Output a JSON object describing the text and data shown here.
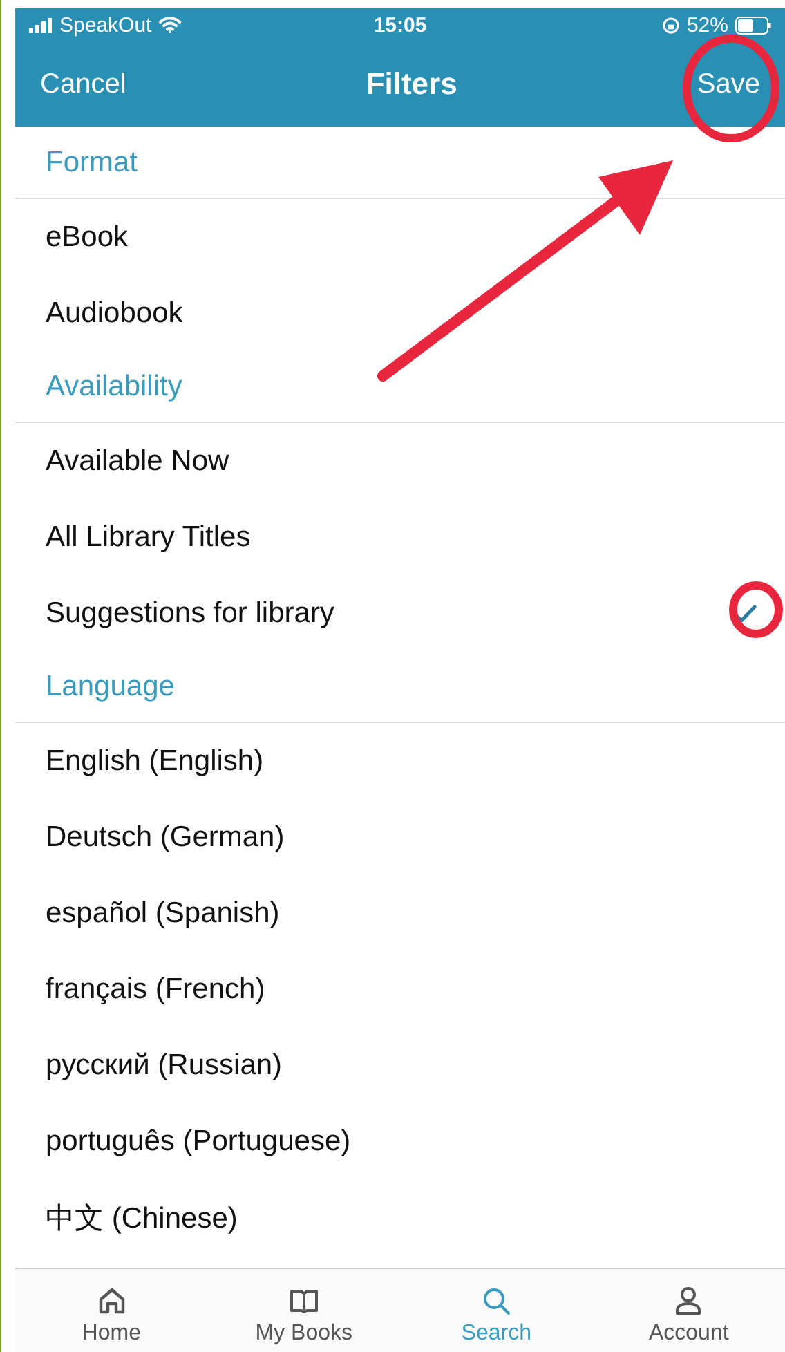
{
  "status_bar": {
    "carrier": "SpeakOut",
    "time": "15:05",
    "battery": "52%"
  },
  "nav": {
    "cancel": "Cancel",
    "title": "Filters",
    "save": "Save"
  },
  "sections": [
    {
      "title": "Format",
      "items": [
        {
          "label": "eBook",
          "selected": false
        },
        {
          "label": "Audiobook",
          "selected": false
        }
      ]
    },
    {
      "title": "Availability",
      "items": [
        {
          "label": "Available Now",
          "selected": false
        },
        {
          "label": "All Library Titles",
          "selected": false
        },
        {
          "label": "Suggestions for library",
          "selected": true
        }
      ]
    },
    {
      "title": "Language",
      "items": [
        {
          "label": "English (English)",
          "selected": false
        },
        {
          "label": "Deutsch (German)",
          "selected": false
        },
        {
          "label": "español (Spanish)",
          "selected": false
        },
        {
          "label": "français (French)",
          "selected": false
        },
        {
          "label": "русский (Russian)",
          "selected": false
        },
        {
          "label": "português (Portuguese)",
          "selected": false
        },
        {
          "label": "中文 (Chinese)",
          "selected": false
        }
      ]
    }
  ],
  "tabs": [
    {
      "label": "Home",
      "selected": false
    },
    {
      "label": "My Books",
      "selected": false
    },
    {
      "label": "Search",
      "selected": true
    },
    {
      "label": "Account",
      "selected": false
    }
  ]
}
